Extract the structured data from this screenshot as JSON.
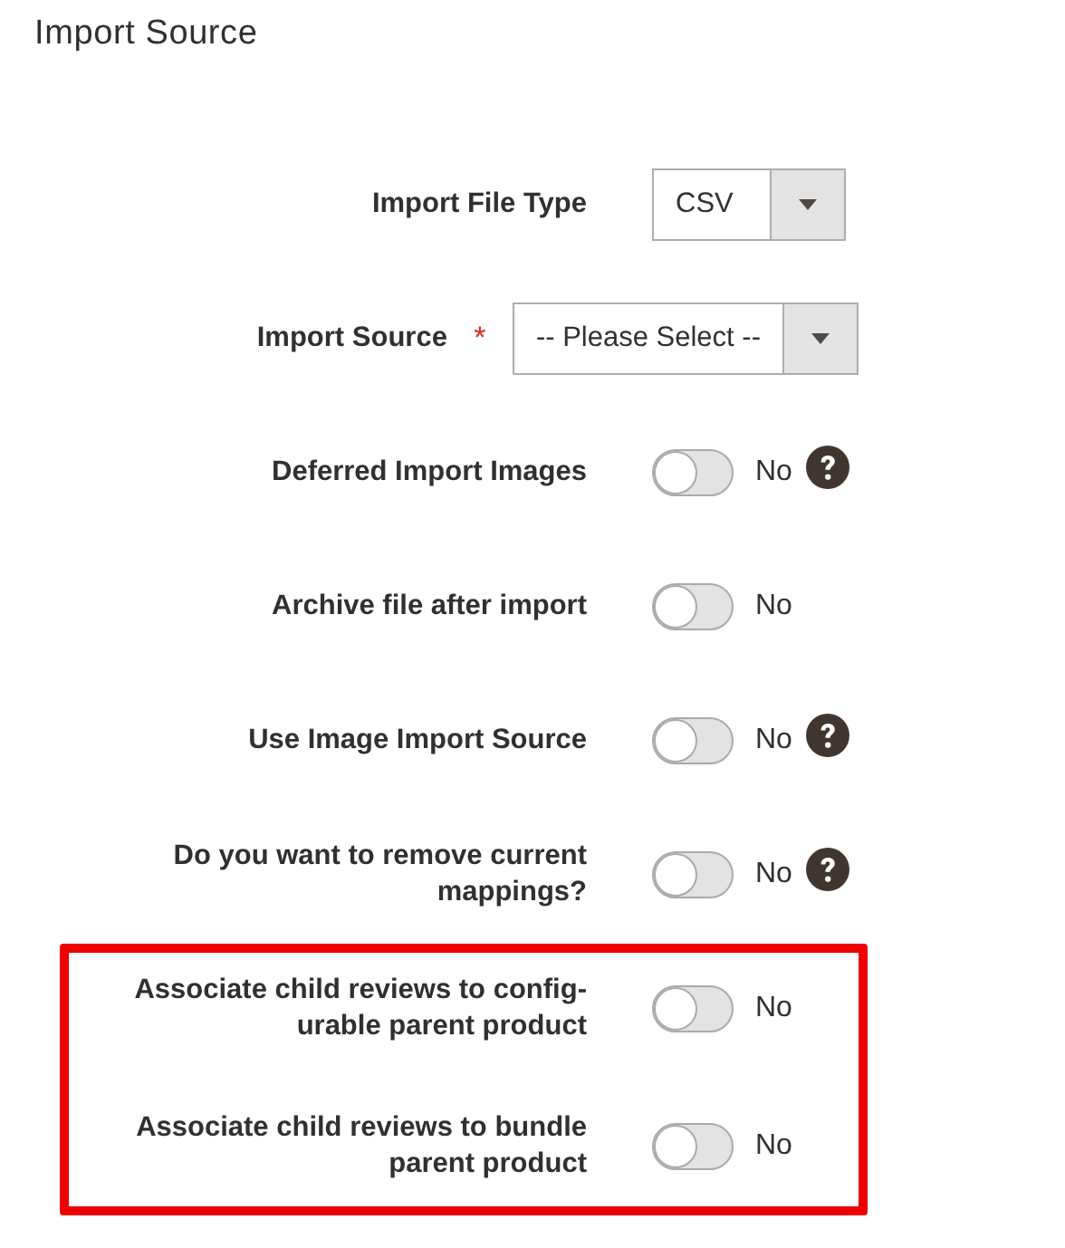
{
  "title": "Import Source",
  "groups": [
    {
      "highlighted": false,
      "rows": [
        {
          "kind": "select",
          "label": "Import File Type",
          "value": "CSV",
          "help": false
        },
        {
          "kind": "select",
          "label": "Import Source",
          "required_mark": "*",
          "value": "-- Please Select --",
          "help": false
        },
        {
          "kind": "toggle",
          "label": "Deferred Import Images",
          "on": false,
          "value": "No",
          "help": true
        },
        {
          "kind": "toggle",
          "label": "Archive file after import",
          "on": false,
          "value": "No",
          "help": false
        },
        {
          "kind": "toggle",
          "label": "Use Image Import Source",
          "on": false,
          "value": "No",
          "help": true
        },
        {
          "kind": "toggle",
          "label": "Do you want to remove current\nmappings?",
          "on": false,
          "value": "No",
          "help": true
        }
      ]
    },
    {
      "highlighted": true,
      "rows": [
        {
          "kind": "toggle",
          "label": "Associate child reviews to config-\nurable parent product",
          "on": false,
          "value": "No",
          "help": false
        },
        {
          "kind": "toggle",
          "label": "Associate child reviews to bundle\nparent product",
          "on": false,
          "value": "No",
          "help": false
        }
      ]
    }
  ]
}
